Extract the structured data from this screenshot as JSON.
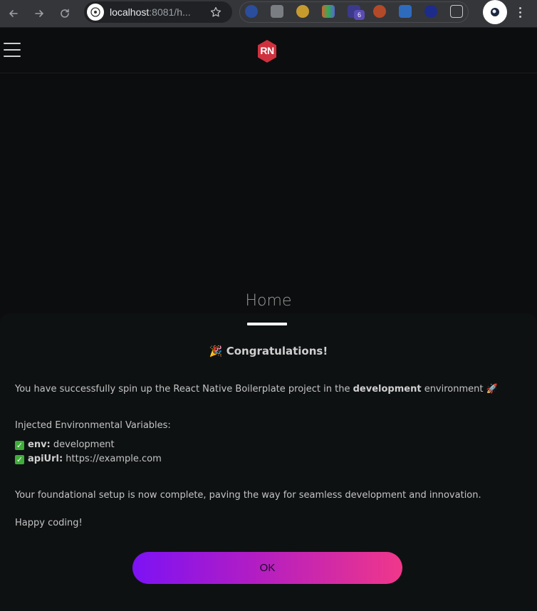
{
  "browser": {
    "url_host": "localhost",
    "url_rest": ":8081/h...",
    "extension_badge": "6"
  },
  "app": {
    "logo_text": "RN",
    "title": "Home"
  },
  "modal": {
    "congrats": "🎉 Congratulations!",
    "intro_pre": "You have successfully spin up the React Native Boilerplate project in the ",
    "intro_env": "development",
    "intro_post": " environment 🚀",
    "vars_heading": "Injected Environmental Variables:",
    "vars": [
      {
        "key": "env:",
        "value": "development"
      },
      {
        "key": "apiUrl:",
        "value": "https://example.com"
      }
    ],
    "closing": "Your foundational setup is now complete, paving the way for seamless development and innovation.",
    "signoff": "Happy coding!",
    "ok_label": "OK"
  },
  "colors": {
    "button_gradient_start": "#7d12f5",
    "button_gradient_end": "#f0378a",
    "background": "#0c0d0e",
    "logo_red": "#d0313f"
  }
}
